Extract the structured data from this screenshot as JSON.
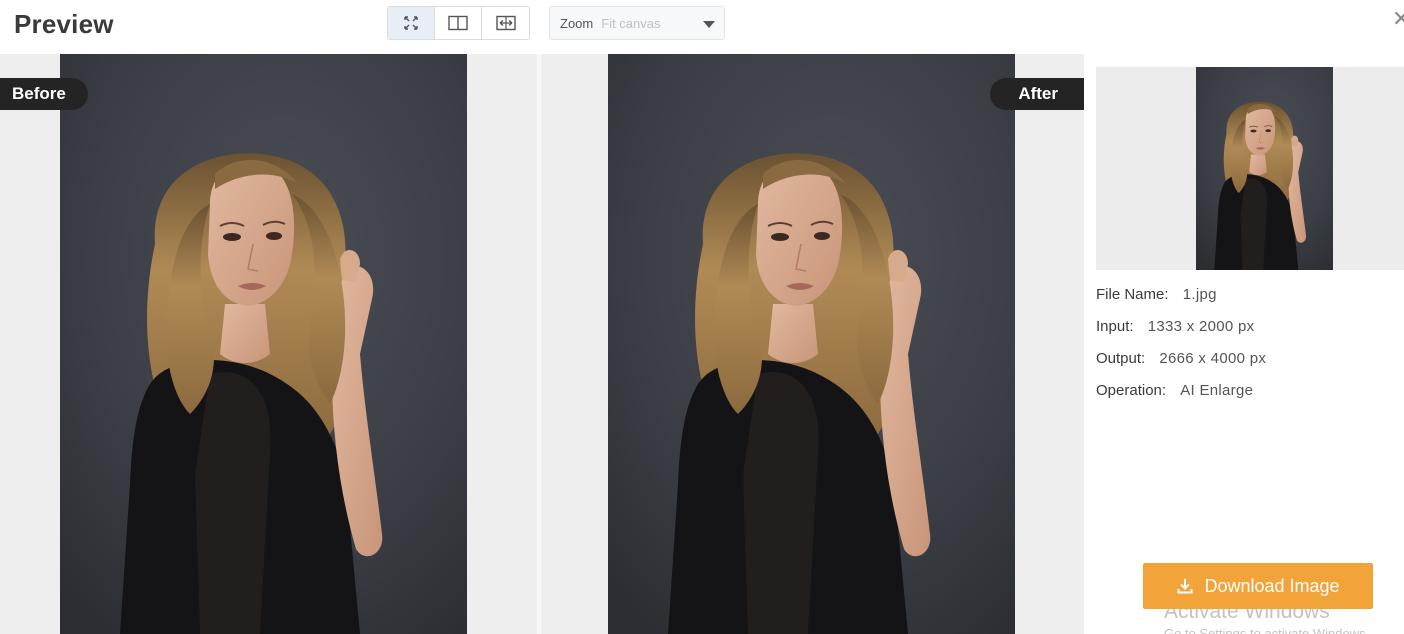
{
  "header": {
    "title": "Preview",
    "view_modes": [
      {
        "icon": "fit-screen-icon",
        "active": true
      },
      {
        "icon": "split-view-icon",
        "active": false
      },
      {
        "icon": "compare-slider-icon",
        "active": false
      }
    ],
    "zoom": {
      "label": "Zoom",
      "value": "Fit canvas"
    },
    "close_glyph": "✕"
  },
  "preview": {
    "before_label": "Before",
    "after_label": "After"
  },
  "sidebar": {
    "info": [
      {
        "key": "File Name:",
        "value": "1.jpg"
      },
      {
        "key": "Input:",
        "value": "1333 x 2000 px"
      },
      {
        "key": "Output:",
        "value": "2666 x 4000 px"
      },
      {
        "key": "Operation:",
        "value": "AI Enlarge"
      }
    ],
    "download_label": "Download Image"
  },
  "os_overlay": {
    "watermark_title": "Activate Windows",
    "watermark_sub": "Go to Settings to activate Windows."
  },
  "colors": {
    "accent": "#f2a33a",
    "tag_bg": "#242424",
    "photo_bg": "#3e4148"
  }
}
